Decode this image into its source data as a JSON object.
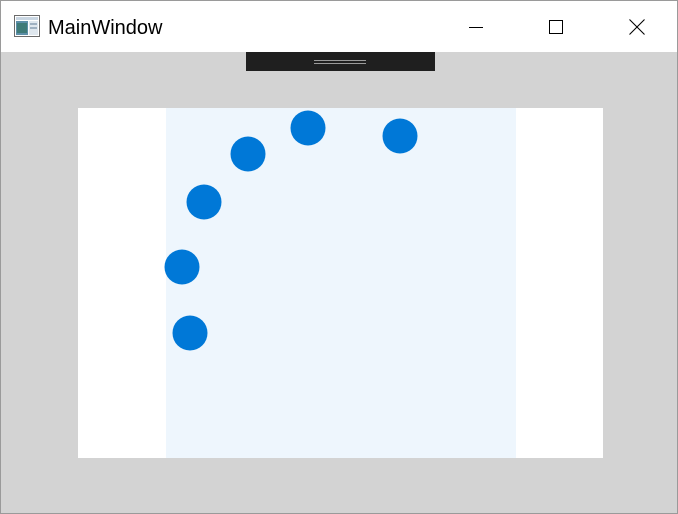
{
  "window": {
    "title": "MainWindow",
    "app_icon": "window-app-icon",
    "caption_buttons": {
      "minimize_icon": "minimize-icon",
      "maximize_icon": "maximize-icon",
      "close_icon": "close-icon"
    }
  },
  "toolbar": {
    "grip_icon": "drag-grip-icon"
  },
  "canvas": {
    "dot_color": "#0078d7",
    "band_color": "#eef6fd",
    "dot_count": 6
  }
}
